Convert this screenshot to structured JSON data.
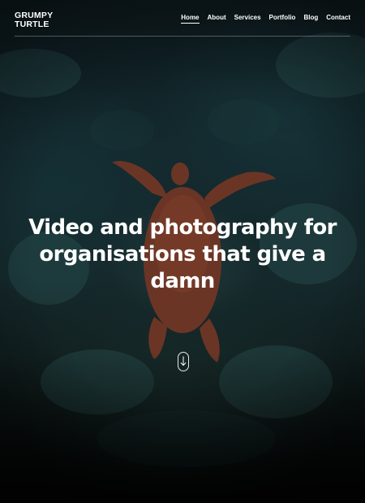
{
  "brand": {
    "logo_line1": "GRUMPY",
    "logo_line2": "TURTLE"
  },
  "nav": {
    "items": [
      {
        "label": "Home",
        "active": true
      },
      {
        "label": "About",
        "active": false
      },
      {
        "label": "Services",
        "active": false
      },
      {
        "label": "Portfolio",
        "active": false
      },
      {
        "label": "Blog",
        "active": false
      },
      {
        "label": "Contact",
        "active": false
      }
    ]
  },
  "hero": {
    "headline_line1": "Video and photography for",
    "headline_line2": "organisations that give a",
    "headline_line3": "damn",
    "scroll_icon": "arrow-down-icon"
  },
  "colors": {
    "text": "#ffffff",
    "ocean_dark": "#0e1c20",
    "turtle_shell": "#6a3524"
  }
}
